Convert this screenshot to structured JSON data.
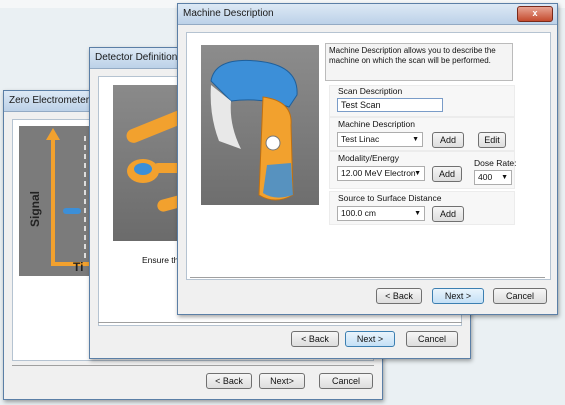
{
  "windows": {
    "zero": {
      "title": "Zero Electrometer",
      "graph": {
        "ylabel": "Signal",
        "xlabel": "Ti"
      },
      "buttons": {
        "back": "< Back",
        "next": "Next>",
        "cancel": "Cancel"
      }
    },
    "detector": {
      "title": "Detector Definition",
      "hint": "Ensure the",
      "buttons": {
        "back": "< Back",
        "next": "Next >",
        "cancel": "Cancel"
      }
    },
    "machine": {
      "title": "Machine Description",
      "close_glyph": "x",
      "description": "Machine Description allows you to describe the machine on which the scan will be performed.",
      "scan_description": {
        "label": "Scan Description",
        "value": "Test Scan"
      },
      "machine_description": {
        "label": "Machine Description",
        "value": "Test Linac",
        "add": "Add",
        "edit": "Edit"
      },
      "modality": {
        "label": "Modality/Energy",
        "value": "12.00 MeV Electron",
        "add": "Add"
      },
      "dose_rate": {
        "label": "Dose Rate:",
        "value": "400"
      },
      "ssd": {
        "label": "Source to Surface Distance",
        "value": "100.0 cm",
        "add": "Add"
      },
      "buttons": {
        "back": "< Back",
        "next": "Next >",
        "cancel": "Cancel"
      }
    }
  },
  "colors": {
    "accent_orange": "#f2a12e",
    "accent_blue": "#3c8fd8",
    "graph_bg": "#7a7a7a"
  }
}
